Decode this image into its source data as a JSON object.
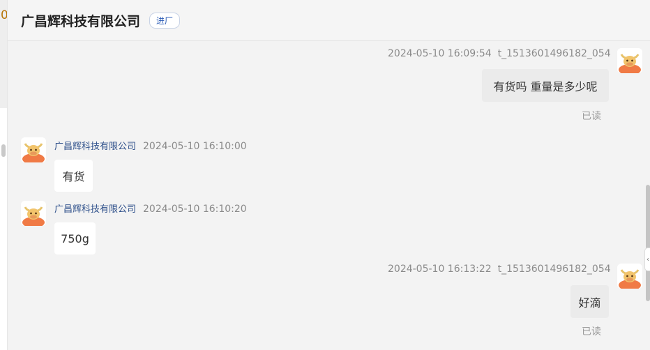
{
  "header": {
    "title": "广昌辉科技有限公司",
    "tag": "进厂"
  },
  "left_peek": "0",
  "messages": [
    {
      "direction": "out",
      "time": "2024-05-10 16:09:54",
      "user": "t_1513601496182_054",
      "text": "有货吗 重量是多少呢",
      "status": "已读"
    },
    {
      "direction": "in",
      "sender": "广昌辉科技有限公司",
      "time": "2024-05-10 16:10:00",
      "text": "有货"
    },
    {
      "direction": "in",
      "sender": "广昌辉科技有限公司",
      "time": "2024-05-10 16:10:20",
      "text": "750g"
    },
    {
      "direction": "out",
      "time": "2024-05-10 16:13:22",
      "user": "t_1513601496182_054",
      "text": "好滴",
      "status": "已读"
    }
  ],
  "colors": {
    "sender": "#2d4f8a",
    "avatar_bg": "#f07a45",
    "tag": "#2a5bb5"
  },
  "icons": {
    "avatar": "bull-avatar-icon",
    "collapse": "chevron-left-icon"
  }
}
